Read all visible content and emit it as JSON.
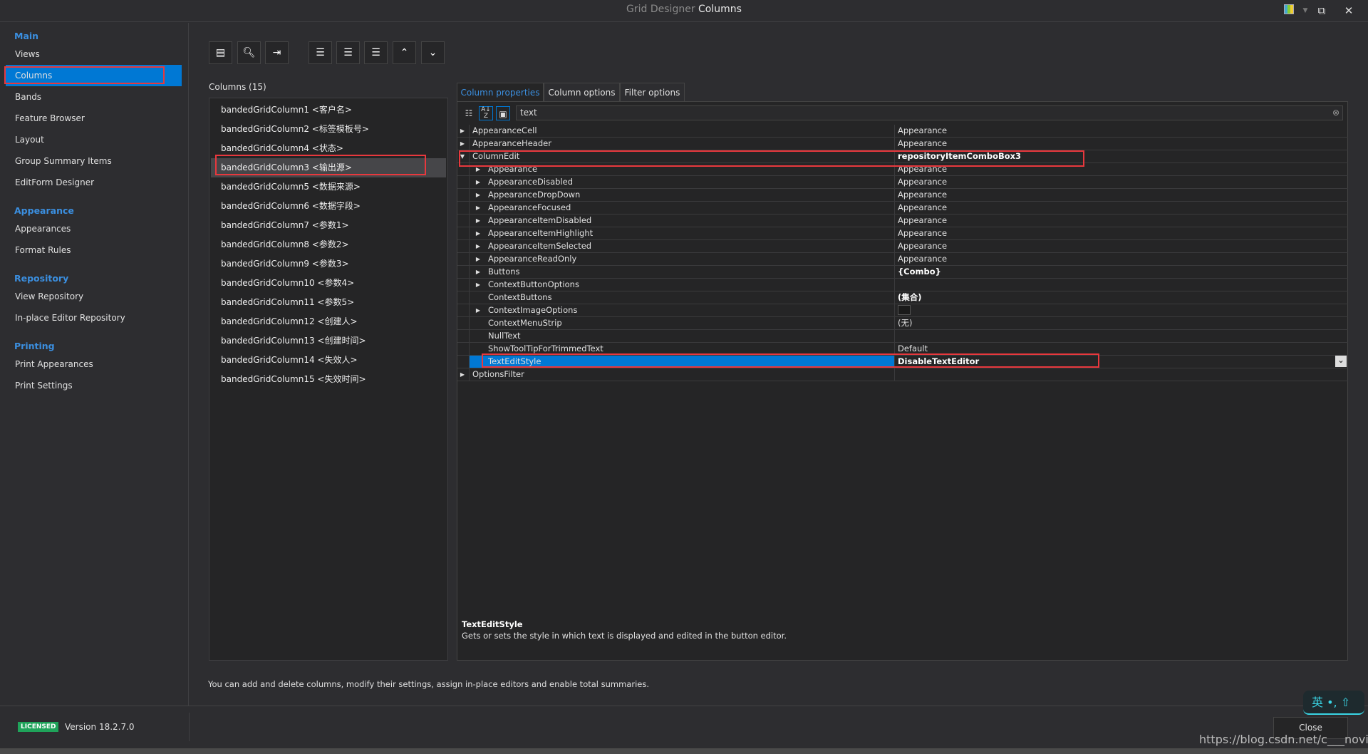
{
  "window": {
    "title_prefix": "Grid Designer",
    "title_main": "Columns"
  },
  "sidebar": {
    "groups": [
      {
        "label": "Main",
        "items": [
          "Views",
          "Columns",
          "Bands",
          "Feature Browser",
          "Layout",
          "Group Summary Items",
          "EditForm Designer"
        ]
      },
      {
        "label": "Appearance",
        "items": [
          "Appearances",
          "Format Rules"
        ]
      },
      {
        "label": "Repository",
        "items": [
          "View Repository",
          "In-place Editor Repository"
        ]
      },
      {
        "label": "Printing",
        "items": [
          "Print Appearances",
          "Print Settings"
        ]
      }
    ],
    "selected": "Columns"
  },
  "columns": {
    "header": "Columns (15)",
    "items": [
      "bandedGridColumn1 <客户名>",
      "bandedGridColumn2 <标签模板号>",
      "bandedGridColumn4 <状态>",
      "bandedGridColumn3 <输出源>",
      "bandedGridColumn5 <数据来源>",
      "bandedGridColumn6 <数据字段>",
      "bandedGridColumn7 <参数1>",
      "bandedGridColumn8 <参数2>",
      "bandedGridColumn9 <参数3>",
      "bandedGridColumn10 <参数4>",
      "bandedGridColumn11 <参数5>",
      "bandedGridColumn12 <创建人>",
      "bandedGridColumn13 <创建时间>",
      "bandedGridColumn14 <失效人>",
      "bandedGridColumn15 <失效时间>"
    ],
    "selected_index": 3
  },
  "tabs": [
    "Column properties",
    "Column options",
    "Filter options"
  ],
  "search": {
    "value": "text"
  },
  "properties": [
    {
      "name": "AppearanceCell",
      "value": "Appearance",
      "level": 0,
      "exp": "collapsed"
    },
    {
      "name": "AppearanceHeader",
      "value": "Appearance",
      "level": 0,
      "exp": "collapsed"
    },
    {
      "name": "ColumnEdit",
      "value": "repositoryItemComboBox3",
      "level": 0,
      "exp": "expanded",
      "bold": true
    },
    {
      "name": "Appearance",
      "value": "Appearance",
      "level": 1,
      "exp": "collapsed"
    },
    {
      "name": "AppearanceDisabled",
      "value": "Appearance",
      "level": 1,
      "exp": "collapsed"
    },
    {
      "name": "AppearanceDropDown",
      "value": "Appearance",
      "level": 1,
      "exp": "collapsed"
    },
    {
      "name": "AppearanceFocused",
      "value": "Appearance",
      "level": 1,
      "exp": "collapsed"
    },
    {
      "name": "AppearanceItemDisabled",
      "value": "Appearance",
      "level": 1,
      "exp": "collapsed"
    },
    {
      "name": "AppearanceItemHighlight",
      "value": "Appearance",
      "level": 1,
      "exp": "collapsed"
    },
    {
      "name": "AppearanceItemSelected",
      "value": "Appearance",
      "level": 1,
      "exp": "collapsed"
    },
    {
      "name": "AppearanceReadOnly",
      "value": "Appearance",
      "level": 1,
      "exp": "collapsed"
    },
    {
      "name": "Buttons",
      "value": "{Combo}",
      "level": 1,
      "exp": "collapsed",
      "bold": true
    },
    {
      "name": "ContextButtonOptions",
      "value": "",
      "level": 1,
      "exp": "collapsed"
    },
    {
      "name": "ContextButtons",
      "value": "(集合)",
      "level": 1,
      "exp": "none",
      "bold": true
    },
    {
      "name": "ContextImageOptions",
      "value": "",
      "level": 1,
      "exp": "collapsed",
      "swatch": true
    },
    {
      "name": "ContextMenuStrip",
      "value": "(无)",
      "level": 1,
      "exp": "none"
    },
    {
      "name": "NullText",
      "value": "",
      "level": 1,
      "exp": "none"
    },
    {
      "name": "ShowToolTipForTrimmedText",
      "value": "Default",
      "level": 1,
      "exp": "none"
    },
    {
      "name": "TextEditStyle",
      "value": "DisableTextEditor",
      "level": 1,
      "exp": "none",
      "bold": true,
      "selected": true
    },
    {
      "name": "OptionsFilter",
      "value": "",
      "level": 0,
      "exp": "collapsed"
    }
  ],
  "description": {
    "title": "TextEditStyle",
    "text": "Gets or sets the style in which text is displayed and edited in the button editor."
  },
  "hint": "You can add and delete columns, modify their settings, assign in-place editors and enable total summaries.",
  "footer": {
    "badge": "LICENSED",
    "version": "Version 18.2.7.0",
    "close": "Close"
  },
  "ime": {
    "lang": "英",
    "punct": "•,"
  },
  "watermark": "https://blog.csdn.net/c___novice",
  "colors": {
    "accent": "#0078d4",
    "highlight": "#e8383d",
    "licensed": "#1fa35a"
  }
}
